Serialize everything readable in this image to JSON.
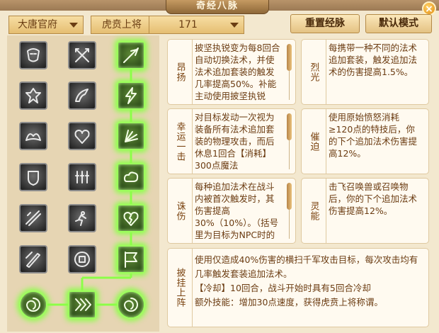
{
  "window": {
    "title": "奇经八脉",
    "close_label": "×"
  },
  "filters": {
    "faction": "大唐官府",
    "title": "虎贲上将",
    "level": "171"
  },
  "buttons": {
    "reset": "重置经脉",
    "default_mode": "默认模式"
  },
  "tree": {
    "columns": [
      {
        "nodes": [
          {
            "icon": "mask-icon",
            "active": false
          },
          {
            "icon": "warrior-icon",
            "active": false
          },
          {
            "icon": "wings-icon",
            "active": false
          },
          {
            "icon": "flame-shield-icon",
            "active": false
          },
          {
            "icon": "double-blade-icon",
            "active": false
          },
          {
            "icon": "sword-slash-icon",
            "active": false
          },
          {
            "icon": "spiral-orb-icon",
            "active": true
          }
        ]
      },
      {
        "nodes": [
          {
            "icon": "cross-blades-icon",
            "active": false
          },
          {
            "icon": "blade-arc-icon",
            "active": false
          },
          {
            "icon": "broken-heart-dark-icon",
            "active": false
          },
          {
            "icon": "soldiers-icon",
            "active": false
          },
          {
            "icon": "runner-icon",
            "active": false
          },
          {
            "icon": "brave-seal-icon",
            "active": false
          },
          {
            "icon": "chevrons-icon",
            "active": true
          }
        ]
      },
      {
        "nodes": [
          {
            "icon": "spear-thrust-icon",
            "active": true
          },
          {
            "icon": "lightning-icon",
            "active": true
          },
          {
            "icon": "fan-blades-icon",
            "active": true
          },
          {
            "icon": "cloud-swirl-icon",
            "active": true
          },
          {
            "icon": "broken-heart-icon",
            "active": true
          },
          {
            "icon": "banner-icon",
            "active": true
          },
          {
            "icon": "spiral-orb-icon",
            "active": true
          }
        ]
      }
    ]
  },
  "abilities": [
    {
      "name": "昂扬",
      "desc": "披坚执锐变为每8回合自动切换法术，并使法术追加套装的触发几率提高50%。补能主动使用披坚执锐",
      "scroll": true
    },
    {
      "name": "烈光",
      "desc": "每携带一种不同的法术追加套装，触发追加法术的伤害提高1.5%。",
      "scroll": false
    },
    {
      "name": "幸运一击",
      "desc": "对目标发动一次视为装备所有法术追加套装的物理攻击，而后休息1回合【消耗】300点魔法",
      "scroll": true
    },
    {
      "name": "催迫",
      "desc": "使用原始愤怒消耗≥120点的特技后，你的下个追加法术伤害提高12%。",
      "scroll": false
    },
    {
      "name": "诛伤",
      "desc": "每种追加法术在战斗内被首次触发时，其伤害提高30%（10%）。（括号里为目标为NPC时的效果）",
      "scroll": true
    },
    {
      "name": "灵能",
      "desc": "击飞召唤兽或召唤物后，你的下个追加法术伤害提高12%。",
      "scroll": false
    },
    {
      "name": "披挂上阵",
      "desc_lines": [
        "使用仅造成40%伤害的横扫千军攻击目标，每次攻击均有几率触发套装追加法术。",
        "【冷却】10回合，战斗开始时具有5回合冷却",
        "额外技能：增加30点速度，获得虎贲上将称谓。"
      ],
      "scroll": false
    }
  ],
  "colors": {
    "active_glow": "#8cff48",
    "panel_bg": "#f3e8cf",
    "text": "#6b3c12"
  }
}
